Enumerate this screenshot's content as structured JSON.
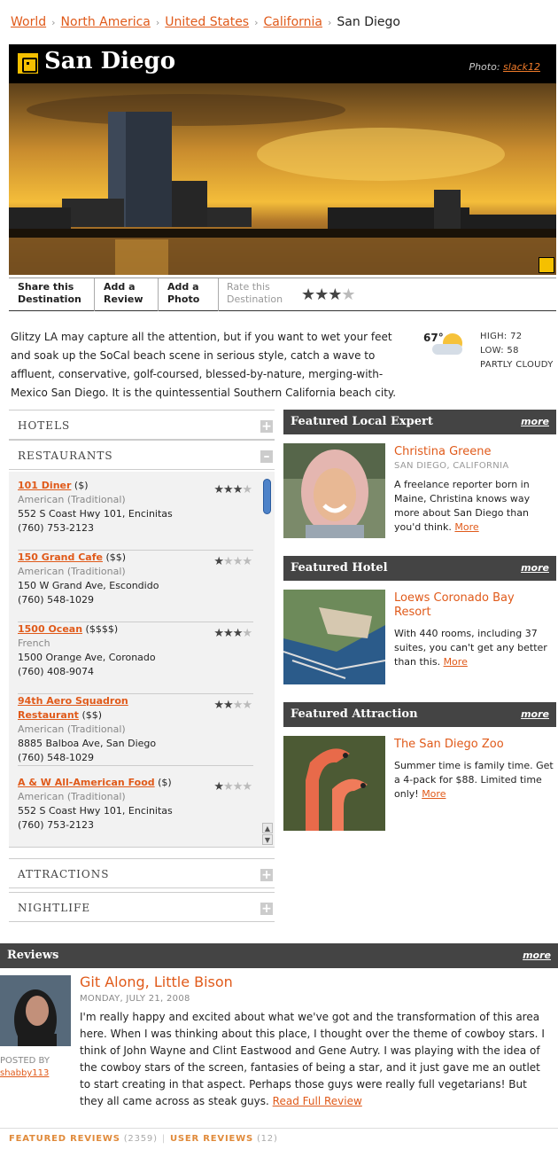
{
  "breadcrumb": {
    "items": [
      "World",
      "North America",
      "United States",
      "California"
    ],
    "current": "San Diego"
  },
  "header": {
    "title": "San Diego",
    "photo_label": "Photo:",
    "photo_credit": "slack12"
  },
  "actions": {
    "share": [
      "Share this",
      "Destination"
    ],
    "review": [
      "Add a",
      "Review"
    ],
    "photo": [
      "Add a",
      "Photo"
    ],
    "rate": [
      "Rate this",
      "Destination"
    ],
    "rating": 3
  },
  "intro": "Glitzy LA may capture all the attention, but if you want to wet your feet and soak up the SoCal beach scene in serious style, catch a wave to affluent, conservative, golf-coursed, blessed-by-nature, merging-with-Mexico San Diego. It is the quintessential Southern California beach city.",
  "weather": {
    "temp": "67°",
    "high": "HIGH: 72",
    "low": "LOW: 58",
    "cond": "PARTLY CLOUDY"
  },
  "categories": {
    "hotels": "HOTELS",
    "restaurants": "RESTAURANTS",
    "attractions": "ATTRACTIONS",
    "nightlife": "NIGHTLIFE"
  },
  "restaurants": [
    {
      "name": "101 Diner",
      "price": "($)",
      "cuisine": "American (Traditional)",
      "addr": "552 S Coast Hwy 101, Encinitas",
      "phone": "(760) 753-2123",
      "stars": 3
    },
    {
      "name": "150 Grand Cafe",
      "price": "($$)",
      "cuisine": "American (Traditional)",
      "addr": "150 W Grand Ave, Escondido",
      "phone": "(760) 548-1029",
      "stars": 1
    },
    {
      "name": "1500 Ocean",
      "price": "($$$$)",
      "cuisine": "French",
      "addr": "1500 Orange Ave, Coronado",
      "phone": "(760) 408-9074",
      "stars": 3
    },
    {
      "name": "94th Aero Squadron Restaurant",
      "price": "($$)",
      "cuisine": "American (Traditional)",
      "addr": "8885 Balboa Ave, San Diego",
      "phone": "(760) 548-1029",
      "stars": 2
    },
    {
      "name": "A & W All-American Food",
      "price": "($)",
      "cuisine": "American (Traditional)",
      "addr": "552 S Coast Hwy 101, Encinitas",
      "phone": "(760) 753-2123",
      "stars": 1
    }
  ],
  "featured": {
    "expert": {
      "heading": "Featured Local Expert",
      "more": "more",
      "name": "Christina Greene",
      "loc": "SAN DIEGO, CALIFORNIA",
      "desc": "A freelance reporter born in Maine, Christina knows way more about San Diego than you'd think.",
      "link": "More"
    },
    "hotel": {
      "heading": "Featured Hotel",
      "more": "more",
      "name": "Loews Coronado Bay Resort",
      "desc": "With 440 rooms, including 37 suites, you can't get any better than this.",
      "link": "More"
    },
    "attraction": {
      "heading": "Featured Attraction",
      "more": "more",
      "name": "The San Diego Zoo",
      "desc": "Summer time is family time. Get a 4-pack for $88. Limited time only!",
      "link": "More"
    }
  },
  "reviews": {
    "heading": "Reviews",
    "more": "more",
    "posted_by": "POSTED BY",
    "user": "shabby113",
    "title": "Git Along, Little Bison",
    "date": "MONDAY, JULY 21, 2008",
    "body": "I'm really happy and excited about what we've got and the transformation of this area here. When I was thinking about this place, I thought over the theme of cowboy stars. I think of John Wayne and Clint Eastwood and Gene Autry. I was playing with the idea of the cowboy stars of the screen, fantasies of being a star, and it just gave me an outlet to start creating in that aspect. Perhaps those guys were really full vegetarians! But they all came across as steak guys.",
    "read_more": "Read Full Review"
  },
  "footer": {
    "featured": "FEATURED REVIEWS",
    "featured_count": "(2359)",
    "user": "USER REVIEWS",
    "user_count": "(12)"
  },
  "colors": {
    "accent": "#e05a1a",
    "header_bg": "#444444",
    "logo": "#f5c000"
  }
}
